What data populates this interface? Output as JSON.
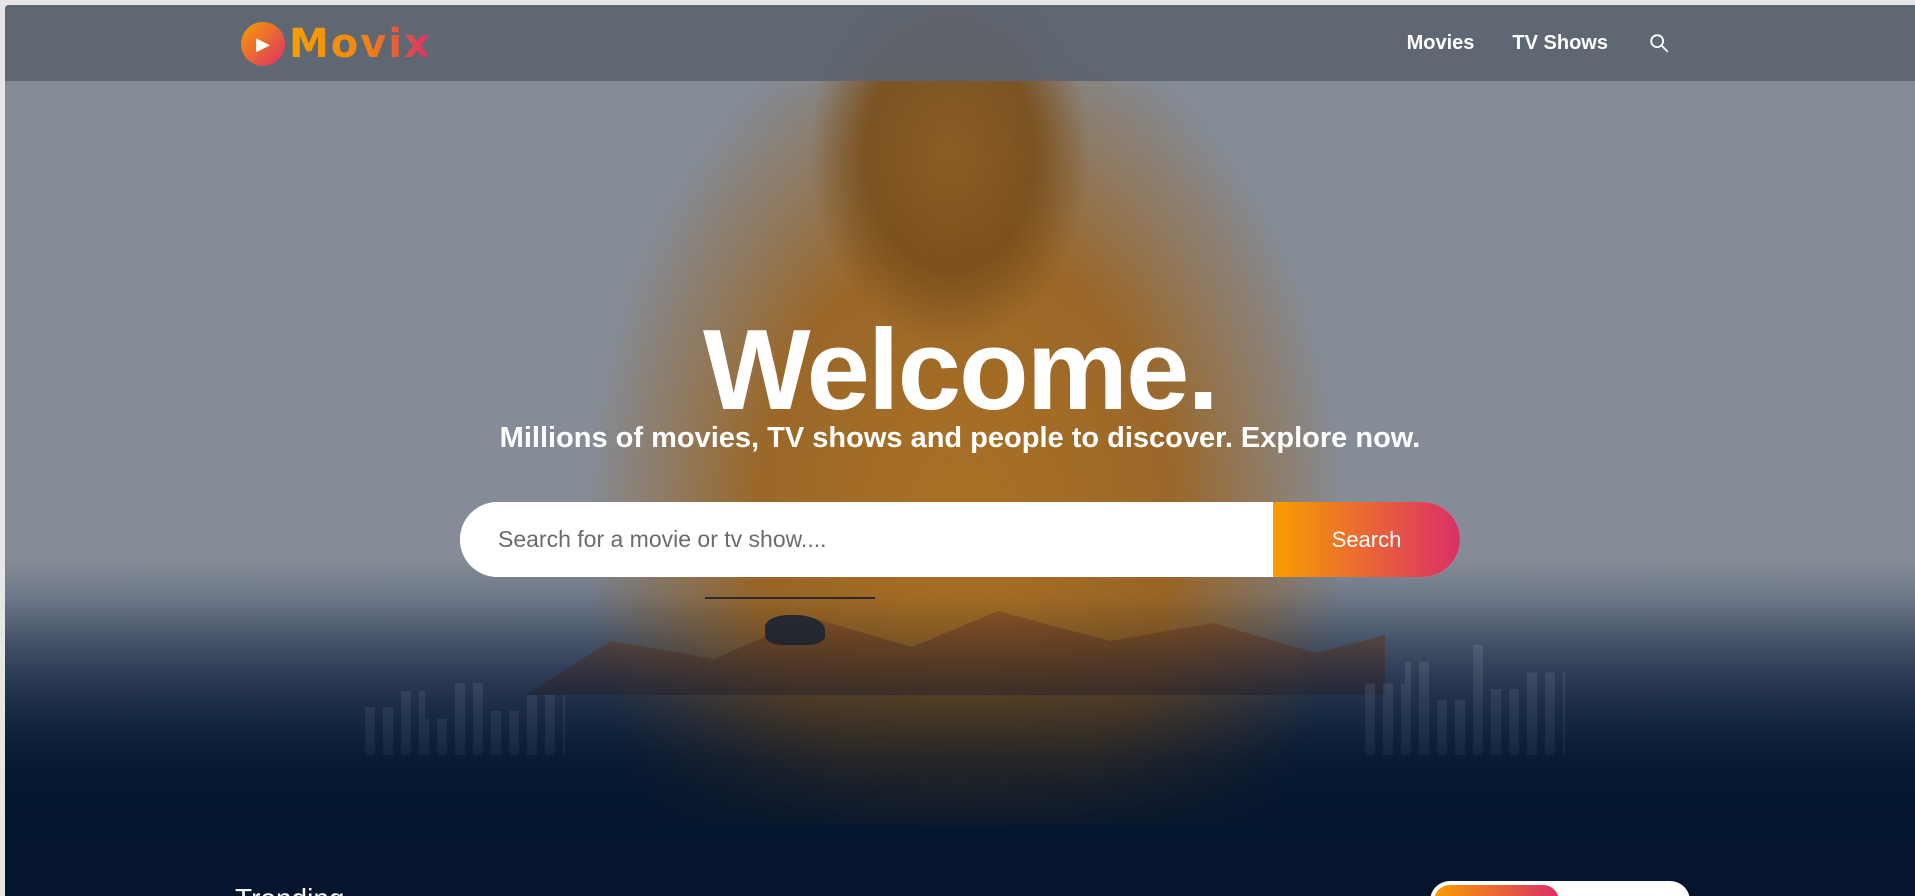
{
  "header": {
    "logo_text": "Movix",
    "nav": {
      "movies": "Movies",
      "tv_shows": "TV Shows"
    },
    "search_icon": "search-icon"
  },
  "hero": {
    "title": "Welcome.",
    "subtitle": "Millions of movies, TV shows and people to discover. Explore now.",
    "search": {
      "placeholder": "Search for a movie or tv show....",
      "button_label": "Search"
    }
  },
  "trending": {
    "title": "Trending"
  },
  "colors": {
    "accent_orange": "#f89e00",
    "accent_pink": "#da2f68",
    "background_navy": "#04152d"
  }
}
